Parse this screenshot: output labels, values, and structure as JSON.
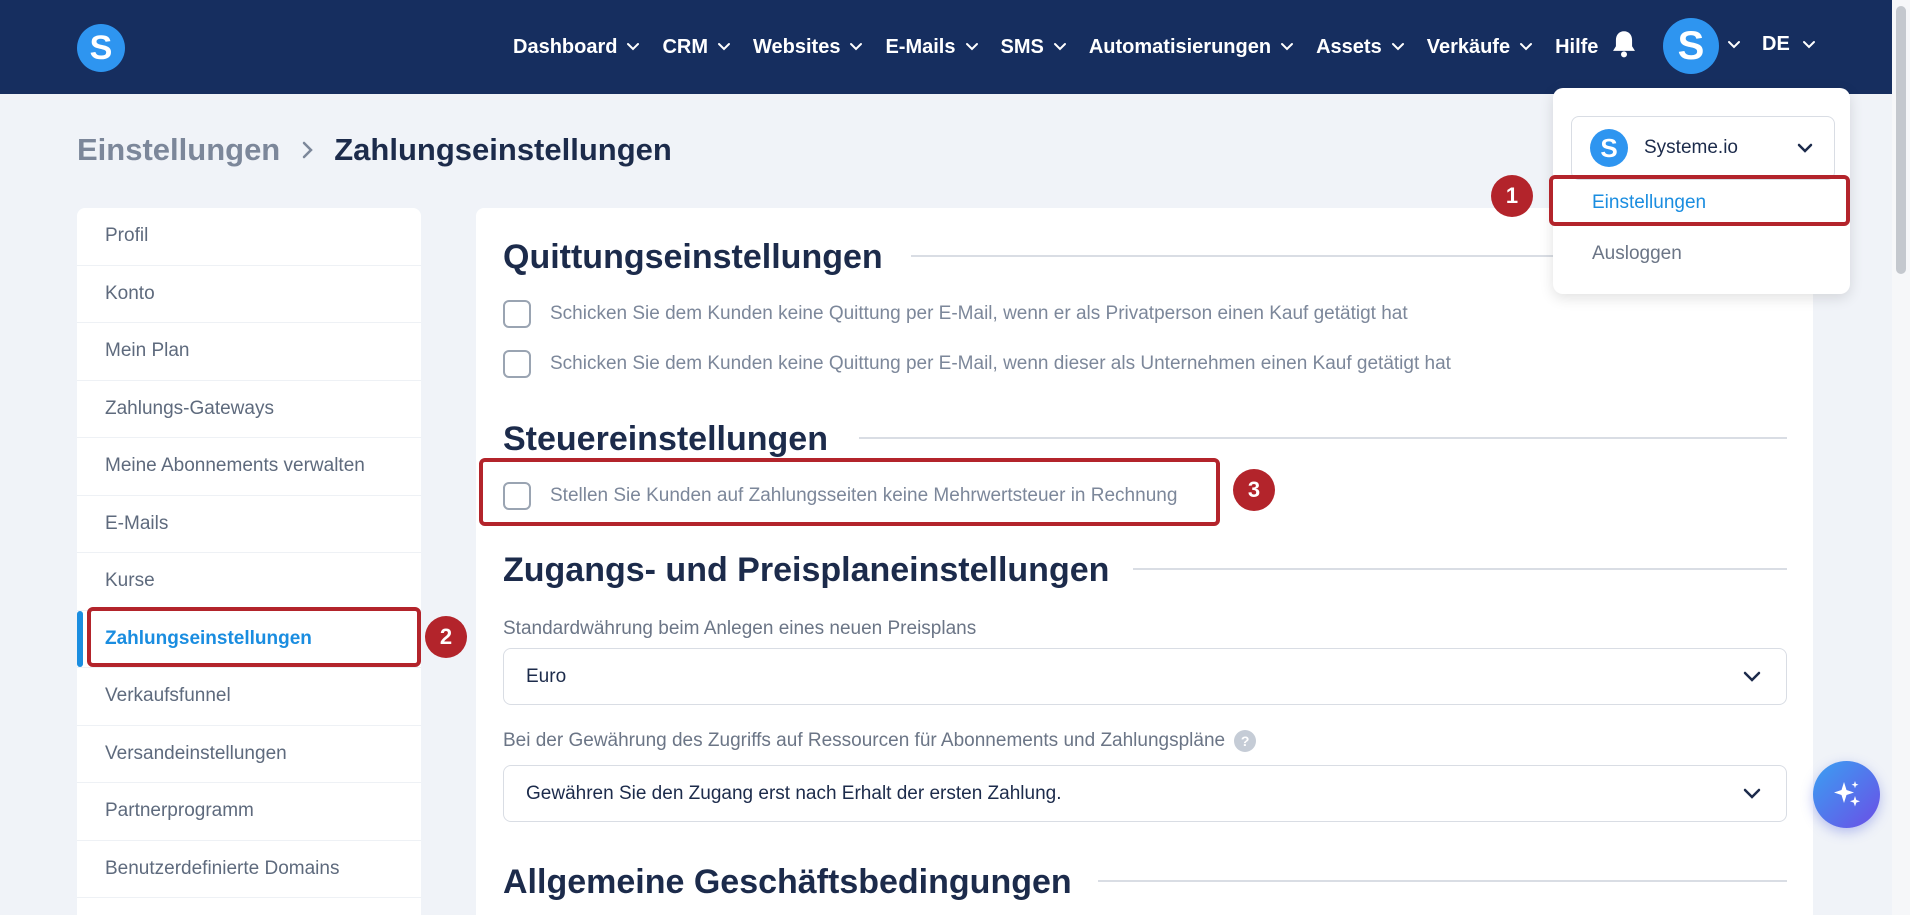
{
  "nav": {
    "logo_letter": "S",
    "items": [
      {
        "label": "Dashboard",
        "has_chevron": true
      },
      {
        "label": "CRM",
        "has_chevron": true
      },
      {
        "label": "Websites",
        "has_chevron": true
      },
      {
        "label": "E-Mails",
        "has_chevron": true
      },
      {
        "label": "SMS",
        "has_chevron": true
      },
      {
        "label": "Automatisierungen",
        "has_chevron": true
      },
      {
        "label": "Assets",
        "has_chevron": true
      },
      {
        "label": "Verkäufe",
        "has_chevron": true
      },
      {
        "label": "Hilfe",
        "has_chevron": false
      }
    ],
    "bell_icon": "bell-icon",
    "avatar_letter": "S",
    "language": "DE"
  },
  "breadcrumb": {
    "parent": "Einstellungen",
    "current": "Zahlungseinstellungen"
  },
  "sidebar": {
    "items": [
      {
        "label": "Profil"
      },
      {
        "label": "Konto"
      },
      {
        "label": "Mein Plan"
      },
      {
        "label": "Zahlungs-Gateways"
      },
      {
        "label": "Meine Abonnements verwalten"
      },
      {
        "label": "E-Mails"
      },
      {
        "label": "Kurse"
      },
      {
        "label": "Zahlungseinstellungen",
        "active": true
      },
      {
        "label": "Verkaufsfunnel"
      },
      {
        "label": "Versandeinstellungen"
      },
      {
        "label": "Partnerprogramm"
      },
      {
        "label": "Benutzerdefinierte Domains"
      }
    ]
  },
  "main": {
    "receipt": {
      "title": "Quittungseinstellungen",
      "options": [
        {
          "label": "Schicken Sie dem Kunden keine Quittung per E-Mail, wenn er als Privatperson einen Kauf getätigt hat",
          "checked": false
        },
        {
          "label": "Schicken Sie dem Kunden keine Quittung per E-Mail, wenn dieser als Unternehmen einen Kauf getätigt hat",
          "checked": false
        }
      ]
    },
    "tax": {
      "title": "Steuereinstellungen",
      "option": {
        "label": "Stellen Sie Kunden auf Zahlungsseiten keine Mehrwertsteuer in Rechnung",
        "checked": false
      }
    },
    "access": {
      "title": "Zugangs- und Preisplaneinstellungen",
      "currency_label": "Standardwährung beim Anlegen eines neuen Preisplans",
      "currency_value": "Euro",
      "access_label": "Bei der Gewährung des Zugriffs auf Ressourcen für Abonnements und Zahlungspläne",
      "help_icon": "question-icon",
      "access_value": "Gewähren Sie den Zugang erst nach Erhalt der ersten Zahlung."
    },
    "terms": {
      "title": "Allgemeine Geschäftsbedingungen"
    }
  },
  "dropdown": {
    "account_name": "Systeme.io",
    "account_logo_letter": "S",
    "settings_label": "Einstellungen",
    "logout_label": "Ausloggen"
  },
  "annotations": {
    "badge1": "1",
    "badge2": "2",
    "badge3": "3",
    "color": "#b3242b"
  },
  "colors": {
    "nav_bg": "#162e5f",
    "accent": "#1a8de0",
    "brand": "#2e95f0"
  },
  "fab_icon": "sparkle-icon"
}
